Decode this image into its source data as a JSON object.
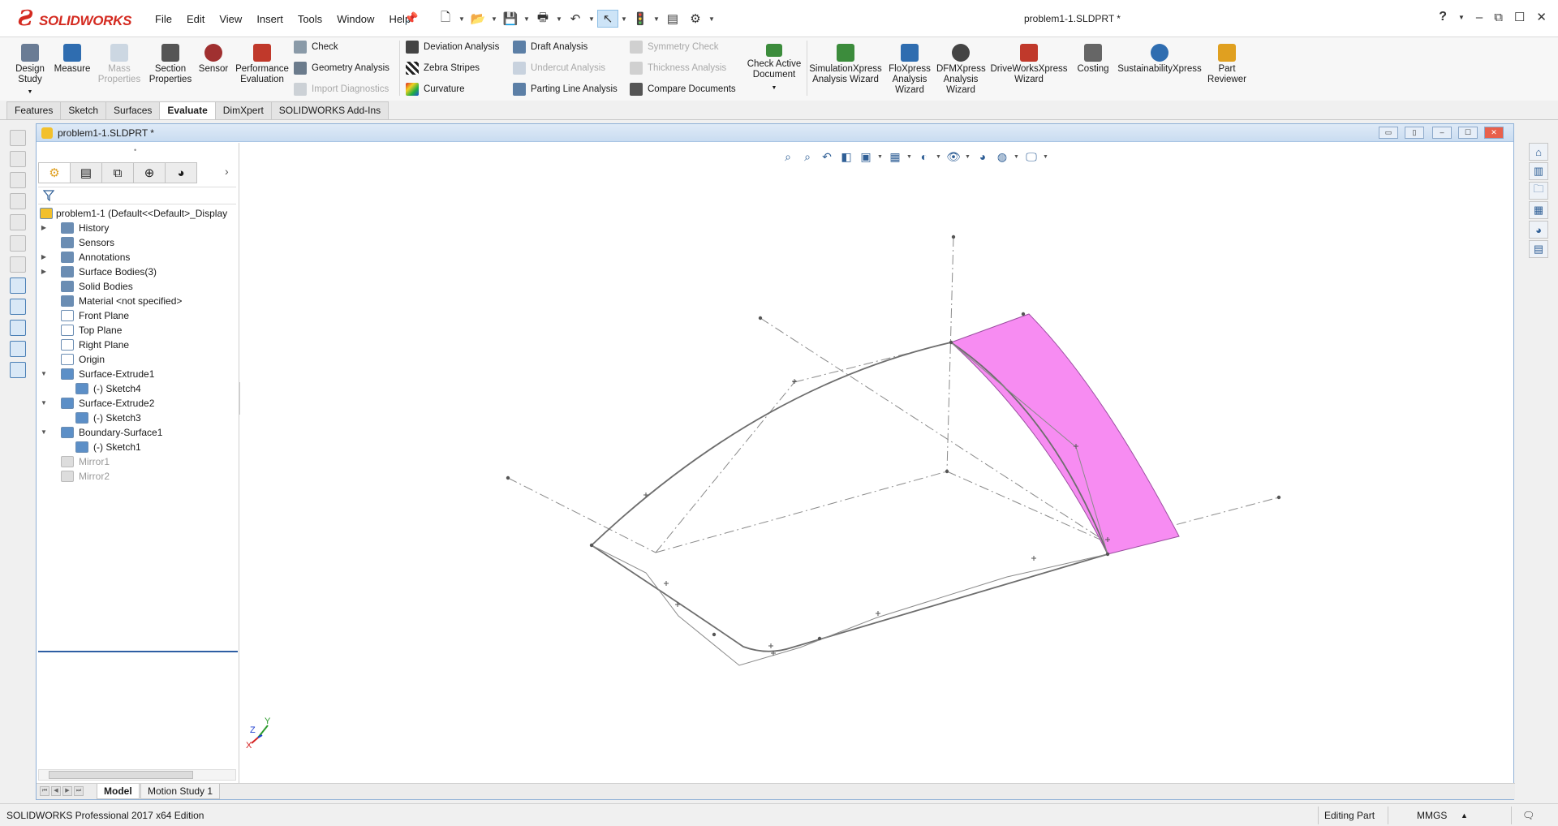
{
  "app": {
    "logo_text": "SOLIDWORKS",
    "document_title": "problem1-1.SLDPRT *"
  },
  "menu": [
    "File",
    "Edit",
    "View",
    "Insert",
    "Tools",
    "Window",
    "Help"
  ],
  "ribbon": {
    "large_buttons": [
      {
        "label": "Design Study",
        "icon": "design-study-icon",
        "enabled": true,
        "color": "#6a7c95"
      },
      {
        "label": "Measure",
        "icon": "measure-icon",
        "enabled": true,
        "color": "#2f6db0"
      },
      {
        "label": "Mass Properties",
        "icon": "mass-properties-icon",
        "enabled": false,
        "color": "#7a9ab9"
      },
      {
        "label": "Section Properties",
        "icon": "section-properties-icon",
        "enabled": true,
        "color": "#555555"
      },
      {
        "label": "Sensor",
        "icon": "sensor-icon",
        "enabled": true,
        "color": "#a03030"
      },
      {
        "label": "Performance Evaluation",
        "icon": "performance-evaluation-icon",
        "enabled": true,
        "color": "#c0392b"
      }
    ],
    "check_group": [
      {
        "label": "Check",
        "icon": "check-icon",
        "enabled": true
      },
      {
        "label": "Geometry Analysis",
        "icon": "geometry-analysis-icon",
        "enabled": true
      },
      {
        "label": "Import Diagnostics",
        "icon": "import-diagnostics-icon",
        "enabled": false
      }
    ],
    "analysis_group_1": [
      {
        "label": "Deviation Analysis",
        "icon": "deviation-analysis-icon",
        "enabled": true
      },
      {
        "label": "Zebra Stripes",
        "icon": "zebra-stripes-icon",
        "enabled": true
      },
      {
        "label": "Curvature",
        "icon": "curvature-icon",
        "enabled": true
      }
    ],
    "analysis_group_2": [
      {
        "label": "Draft Analysis",
        "icon": "draft-analysis-icon",
        "enabled": true
      },
      {
        "label": "Undercut Analysis",
        "icon": "undercut-analysis-icon",
        "enabled": false
      },
      {
        "label": "Parting Line Analysis",
        "icon": "parting-line-analysis-icon",
        "enabled": true
      }
    ],
    "analysis_group_3": [
      {
        "label": "Symmetry Check",
        "icon": "symmetry-check-icon",
        "enabled": false
      },
      {
        "label": "Thickness Analysis",
        "icon": "thickness-analysis-icon",
        "enabled": false
      },
      {
        "label": "Compare Documents",
        "icon": "compare-documents-icon",
        "enabled": true
      }
    ],
    "check_active": {
      "label": "Check Active Document",
      "icon": "check-active-document-icon"
    },
    "xpress_buttons": [
      {
        "label": "SimulationXpress Analysis Wizard",
        "icon": "simulationxpress-icon",
        "color": "#3c8c3c"
      },
      {
        "label": "FloXpress Analysis Wizard",
        "icon": "floxpress-icon",
        "color": "#2f6db0"
      },
      {
        "label": "DFMXpress Analysis Wizard",
        "icon": "dfmxpress-icon",
        "color": "#444444"
      },
      {
        "label": "DriveWorksXpress Wizard",
        "icon": "driveworksxpress-icon",
        "color": "#c0392b"
      },
      {
        "label": "Costing",
        "icon": "costing-icon",
        "color": "#666666"
      },
      {
        "label": "SustainabilityXpress",
        "icon": "sustainabilityxpress-icon",
        "color": "#2f6db0"
      },
      {
        "label": "Part Reviewer",
        "icon": "part-reviewer-icon",
        "color": "#e0a020"
      }
    ]
  },
  "tabs": [
    {
      "label": "Features",
      "active": false
    },
    {
      "label": "Sketch",
      "active": false
    },
    {
      "label": "Surfaces",
      "active": false
    },
    {
      "label": "Evaluate",
      "active": true
    },
    {
      "label": "DimXpert",
      "active": false
    },
    {
      "label": "SOLIDWORKS Add-Ins",
      "active": false
    }
  ],
  "doc_window": {
    "title": "problem1-1.SLDPRT *"
  },
  "feature_tree": [
    {
      "label": "problem1-1  (Default<<Default>_Display",
      "icon": "part-icon",
      "indent": 0,
      "expander": "",
      "dim": false
    },
    {
      "label": "History",
      "icon": "history-icon",
      "indent": 1,
      "expander": "right",
      "dim": false
    },
    {
      "label": "Sensors",
      "icon": "sensors-icon",
      "indent": 1,
      "expander": "",
      "dim": false
    },
    {
      "label": "Annotations",
      "icon": "annotations-icon",
      "indent": 1,
      "expander": "right",
      "dim": false
    },
    {
      "label": "Surface Bodies(3)",
      "icon": "surface-bodies-icon",
      "indent": 1,
      "expander": "right",
      "dim": false
    },
    {
      "label": "Solid Bodies",
      "icon": "solid-bodies-icon",
      "indent": 1,
      "expander": "",
      "dim": false
    },
    {
      "label": "Material <not specified>",
      "icon": "material-icon",
      "indent": 1,
      "expander": "",
      "dim": false
    },
    {
      "label": "Front Plane",
      "icon": "plane-icon",
      "indent": 1,
      "expander": "",
      "dim": false
    },
    {
      "label": "Top Plane",
      "icon": "plane-icon",
      "indent": 1,
      "expander": "",
      "dim": false
    },
    {
      "label": "Right Plane",
      "icon": "plane-icon",
      "indent": 1,
      "expander": "",
      "dim": false
    },
    {
      "label": "Origin",
      "icon": "origin-icon",
      "indent": 1,
      "expander": "",
      "dim": false
    },
    {
      "label": "Surface-Extrude1",
      "icon": "surface-extrude-icon",
      "indent": 1,
      "expander": "down",
      "dim": false
    },
    {
      "label": "(-) Sketch4",
      "icon": "sketch-icon",
      "indent": 2,
      "expander": "",
      "dim": false
    },
    {
      "label": "Surface-Extrude2",
      "icon": "surface-extrude-icon",
      "indent": 1,
      "expander": "down",
      "dim": false
    },
    {
      "label": "(-) Sketch3",
      "icon": "sketch-icon",
      "indent": 2,
      "expander": "",
      "dim": false
    },
    {
      "label": "Boundary-Surface1",
      "icon": "boundary-surface-icon",
      "indent": 1,
      "expander": "down",
      "dim": false
    },
    {
      "label": "(-) Sketch1",
      "icon": "sketch-icon",
      "indent": 2,
      "expander": "",
      "dim": false
    },
    {
      "label": "Mirror1",
      "icon": "mirror-icon",
      "indent": 1,
      "expander": "",
      "dim": true
    },
    {
      "label": "Mirror2",
      "icon": "mirror-icon",
      "indent": 1,
      "expander": "",
      "dim": true
    }
  ],
  "model_tabs": [
    {
      "label": "Model",
      "active": true
    },
    {
      "label": "Motion Study 1",
      "active": false
    }
  ],
  "status": {
    "edition": "SOLIDWORKS Professional 2017 x64 Edition",
    "mode": "Editing Part",
    "units": "MMGS"
  },
  "colors": {
    "surface_fill": "#f78cf2",
    "surface_edge": "#9b4fa0",
    "curve": "#6d6d6d",
    "construction": "#8a8a8a",
    "accent": "#2e5ea3"
  },
  "triad": {
    "x": "X",
    "y": "Y",
    "z": "Z"
  }
}
